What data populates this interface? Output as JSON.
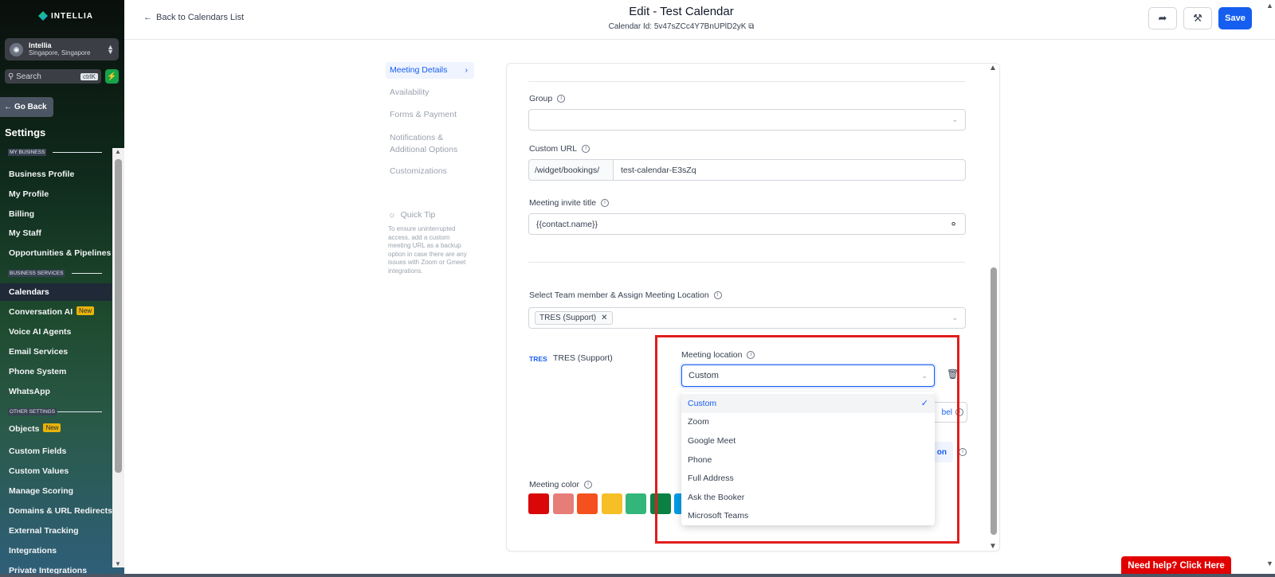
{
  "sidebar": {
    "brand": "INTELLIA",
    "account": {
      "name": "Intellia",
      "location": "Singapore, Singapore"
    },
    "search": {
      "placeholder": "Search",
      "shortcut": "ctrlK"
    },
    "go_back": "Go Back",
    "title": "Settings",
    "sections": {
      "my_business": "MY BUSINESS",
      "business_services": "BUSINESS SERVICES",
      "other_settings": "OTHER SETTINGS"
    },
    "items": {
      "business_profile": "Business Profile",
      "my_profile": "My Profile",
      "billing": "Billing",
      "my_staff": "My Staff",
      "opportunities": "Opportunities & Pipelines",
      "calendars": "Calendars",
      "conversation_ai": "Conversation AI",
      "voice_ai": "Voice AI Agents",
      "email_services": "Email Services",
      "phone_system": "Phone System",
      "whatsapp": "WhatsApp",
      "objects": "Objects",
      "custom_fields": "Custom Fields",
      "custom_values": "Custom Values",
      "manage_scoring": "Manage Scoring",
      "domains": "Domains & URL Redirects",
      "external_tracking": "External Tracking",
      "integrations": "Integrations",
      "private_integrations": "Private Integrations"
    },
    "new_badge": "New"
  },
  "header": {
    "back_label": "Back to Calendars List",
    "title": "Edit - Test Calendar",
    "calendar_id": "Calendar Id: 5v47sZCc4Y7BnUPlD2yK",
    "save_label": "Save"
  },
  "subnav": {
    "items": [
      "Meeting Details",
      "Availability",
      "Forms & Payment",
      "Notifications &",
      "Additional Options",
      "Customizations"
    ],
    "tip_title": "Quick Tip",
    "tip_text": "To ensure uninterrupted access, add a custom meeting URL as a backup option in case there are any issues with Zoom or Gmeet integrations."
  },
  "form": {
    "group_label": "Group",
    "group_value": "",
    "custom_url_label": "Custom URL",
    "url_prefix": "/widget/bookings/",
    "url_value": "test-calendar-E3sZq",
    "invite_title_label": "Meeting invite title",
    "invite_title_value": "{{contact.name}}",
    "team_label": "Select Team member & Assign Meeting Location",
    "team_tag": "TRES (Support)",
    "member_logo": "TRES",
    "member_name": "TRES (Support)",
    "meeting_location_label": "Meeting location",
    "meeting_location_value": "Custom",
    "behind_btn_text": "bel",
    "behind_btn2_text": "on",
    "meeting_color_label": "Meeting color",
    "colors": [
      "#d90707",
      "#e77d78",
      "#f4511e",
      "#f6bf26",
      "#33b679",
      "#0b8043",
      "#039be5"
    ]
  },
  "dropdown": {
    "options": [
      "Custom",
      "Zoom",
      "Google Meet",
      "Phone",
      "Full Address",
      "Ask the Booker",
      "Microsoft Teams"
    ],
    "selected": "Custom"
  },
  "help_button": "Need help? Click Here"
}
